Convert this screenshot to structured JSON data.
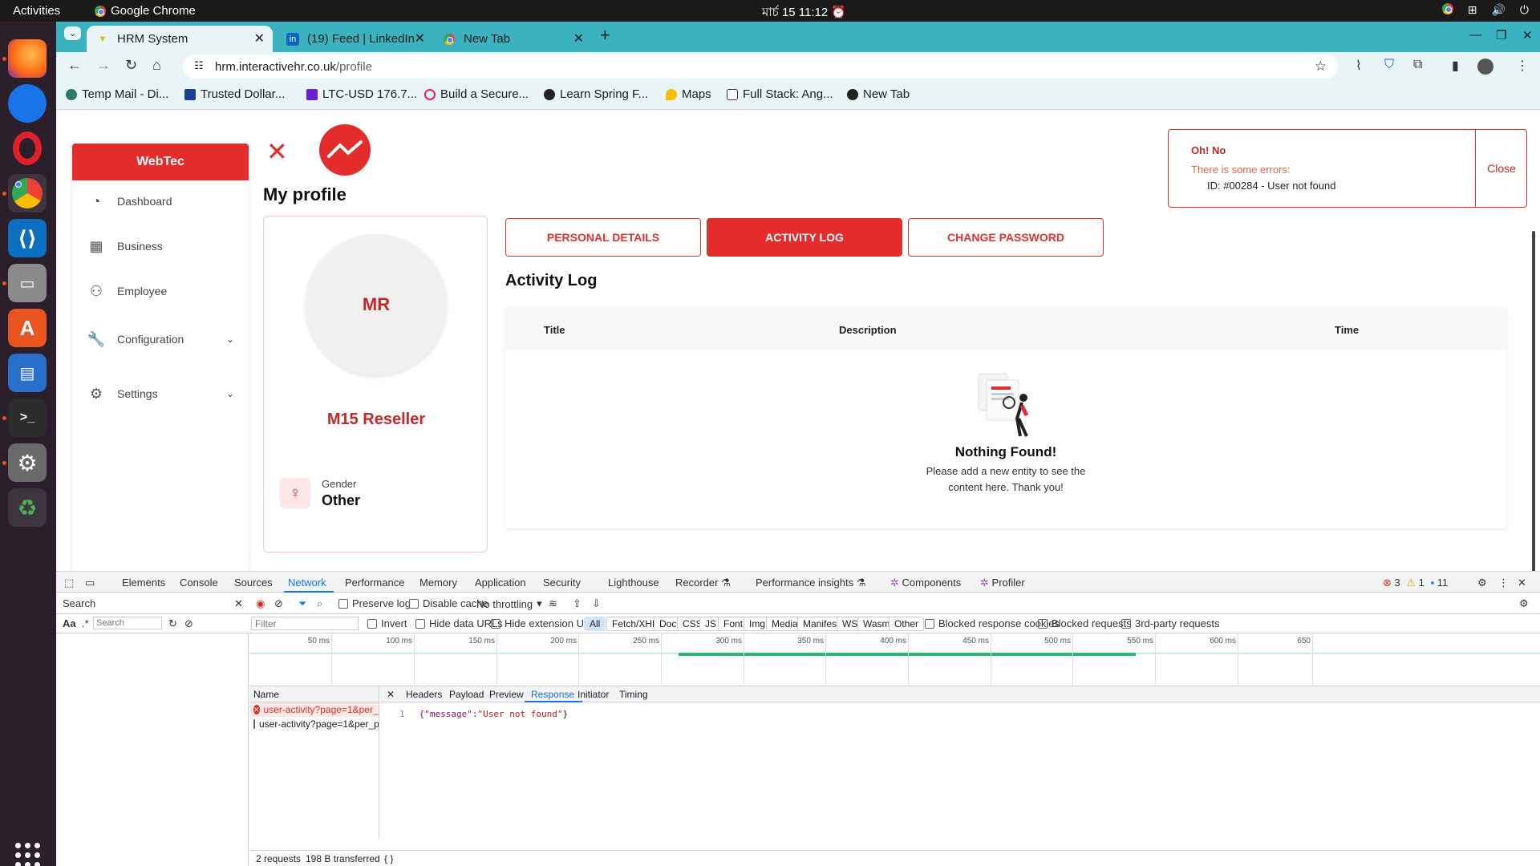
{
  "topbar": {
    "activities": "Activities",
    "app_name": "Google Chrome",
    "clock": "মার্চ 15  11:12"
  },
  "browser": {
    "tabs": [
      {
        "title": "HRM System",
        "active": true
      },
      {
        "title": "(19) Feed | LinkedIn",
        "active": false
      },
      {
        "title": "New Tab",
        "active": false
      }
    ],
    "url_host": "hrm.interactivehr.co.uk",
    "url_path": "/profile",
    "bookmarks": [
      "Temp Mail - Di...",
      "Trusted Dollar...",
      "LTC-USD 176.7...",
      "Build a Secure...",
      "Learn Spring F...",
      "Maps",
      "Full Stack: Ang...",
      "New Tab"
    ]
  },
  "app": {
    "brand": "WebTec",
    "nav": [
      {
        "label": "Dashboard",
        "icon": "gauge-icon"
      },
      {
        "label": "Business",
        "icon": "briefcase-icon"
      },
      {
        "label": "Employee",
        "icon": "people-icon"
      },
      {
        "label": "Configuration",
        "icon": "wrench-icon"
      },
      {
        "label": "Settings",
        "icon": "gear-icon"
      }
    ],
    "page_title": "My profile",
    "profile": {
      "initials": "MR",
      "name": "M15 Reseller",
      "gender_label": "Gender",
      "gender_value": "Other"
    },
    "profile_tabs": [
      {
        "label": "PERSONAL DETAILS",
        "active": false
      },
      {
        "label": "ACTIVITY LOG",
        "active": true
      },
      {
        "label": "CHANGE PASSWORD",
        "active": false
      }
    ],
    "activity": {
      "title": "Activity Log",
      "columns": [
        "Title",
        "Description",
        "Time"
      ],
      "empty_title": "Nothing Found!",
      "empty_text": "Please add a new entity to see the content here. Thank you!"
    },
    "toast": {
      "title": "Oh! No",
      "subtitle": "There is some errors:",
      "message": "ID: #00284 - User not found",
      "close": "Close"
    }
  },
  "devtools": {
    "tabs": [
      "Elements",
      "Console",
      "Sources",
      "Network",
      "Performance",
      "Memory",
      "Application",
      "Security",
      "Lighthouse",
      "Recorder ⚗",
      "Performance insights ⚗",
      "Components",
      "Profiler"
    ],
    "active_tab": "Network",
    "counts": {
      "errors": "3",
      "warnings": "1",
      "messages": "11"
    },
    "search_label": "Search",
    "preserve_log": "Preserve log",
    "disable_cache": "Disable cache",
    "throttling": "No throttling",
    "search_placeholder": "Search",
    "filter_placeholder": "Filter",
    "invert": "Invert",
    "hide_data_urls": "Hide data URLs",
    "hide_ext_urls": "Hide extension URLs",
    "type_filters": [
      "All",
      "Fetch/XHR",
      "Doc",
      "CSS",
      "JS",
      "Font",
      "Img",
      "Media",
      "Manifest",
      "WS",
      "Wasm",
      "Other"
    ],
    "blocked_cookies": "Blocked response cookies",
    "blocked_requests": "Blocked requests",
    "third_party": "3rd-party requests",
    "timeline_ticks": [
      "50 ms",
      "100 ms",
      "150 ms",
      "200 ms",
      "250 ms",
      "300 ms",
      "350 ms",
      "400 ms",
      "450 ms",
      "500 ms",
      "550 ms",
      "600 ms",
      "650"
    ],
    "name_header": "Name",
    "requests": [
      {
        "name": "user-activity?page=1&per_pa...",
        "error": true
      },
      {
        "name": "user-activity?page=1&per_pa...",
        "error": false
      }
    ],
    "detail_tabs": [
      "Headers",
      "Payload",
      "Preview",
      "Response",
      "Initiator",
      "Timing"
    ],
    "active_detail_tab": "Response",
    "response_line_no": "1",
    "response_key": "{\"message\":",
    "response_value": "\"User not found\"",
    "response_end": "}",
    "status_requests": "2 requests",
    "status_transferred": "198 B transferred"
  }
}
